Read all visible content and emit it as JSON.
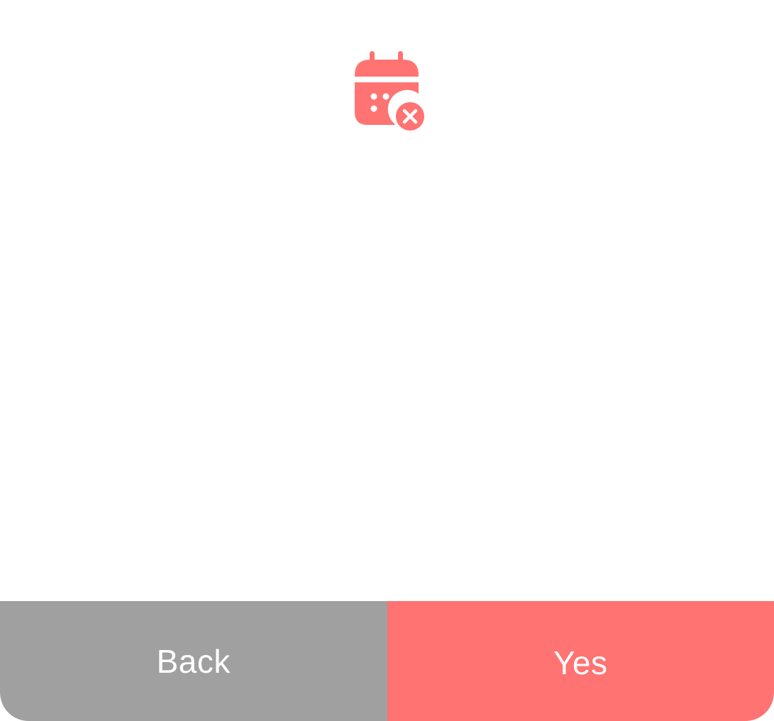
{
  "dialog": {
    "icon": "calendar-cancel-icon",
    "accent_color": "#ff7373",
    "actions": {
      "back_label": "Back",
      "back_color": "#a0a0a0",
      "yes_label": "Yes",
      "yes_color": "#ff7373"
    }
  }
}
